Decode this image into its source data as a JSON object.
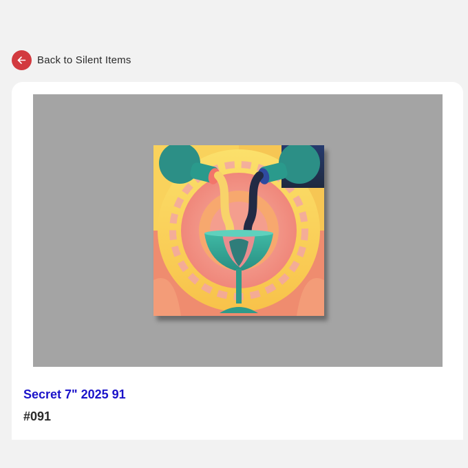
{
  "nav": {
    "back_label": "Back to Silent Items",
    "back_icon": "arrow-left-icon",
    "back_icon_color": "#d23a3f"
  },
  "item": {
    "title": "Secret 7\" 2025 91",
    "number": "#091",
    "title_color": "#1a12c9"
  },
  "artwork": {
    "icon": "record-sleeve-artwork",
    "background_color": "#a4a4a4"
  }
}
